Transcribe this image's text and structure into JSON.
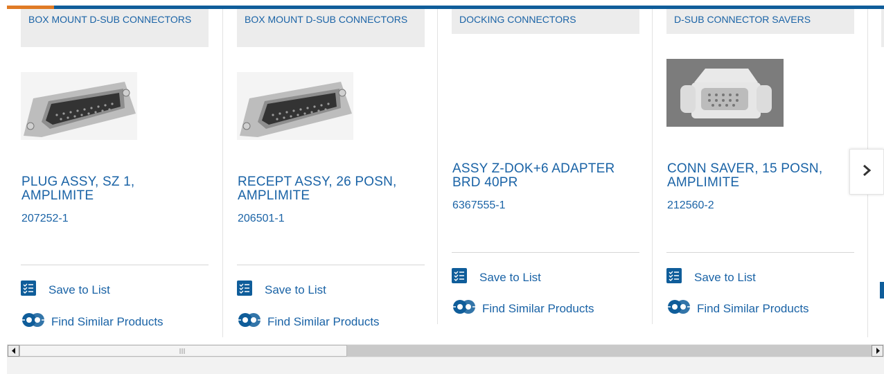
{
  "carousel": {
    "products": [
      {
        "category": "BOX MOUNT D-SUB CONNECTORS",
        "title": "PLUG ASSY, SZ 1, AMPLIMITE",
        "part_number": "207252-1",
        "save_label": "Save to List",
        "find_label": "Find Similar Products"
      },
      {
        "category": "BOX MOUNT D-SUB CONNECTORS",
        "title": "RECEPT ASSY, 26 POSN, AMPLIMITE",
        "part_number": "206501-1",
        "save_label": "Save to List",
        "find_label": "Find Similar Products"
      },
      {
        "category": "DOCKING CONNECTORS",
        "title": "ASSY Z-DOK+6 ADAPTER BRD 40PR",
        "part_number": "6367555-1",
        "save_label": "Save to List",
        "find_label": "Find Similar Products"
      },
      {
        "category": "D-SUB CONNECTOR SAVERS",
        "title": "CONN SAVER, 15 POSN, AMPLIMITE",
        "part_number": "212560-2",
        "save_label": "Save to List",
        "find_label": "Find Similar Products"
      }
    ],
    "next_icon": "chevron-right-icon"
  },
  "colors": {
    "link_blue": "#1a63a6",
    "header_bar_blue": "#0f5d9a",
    "header_bar_orange": "#e07b25",
    "category_bg": "#ececec"
  }
}
